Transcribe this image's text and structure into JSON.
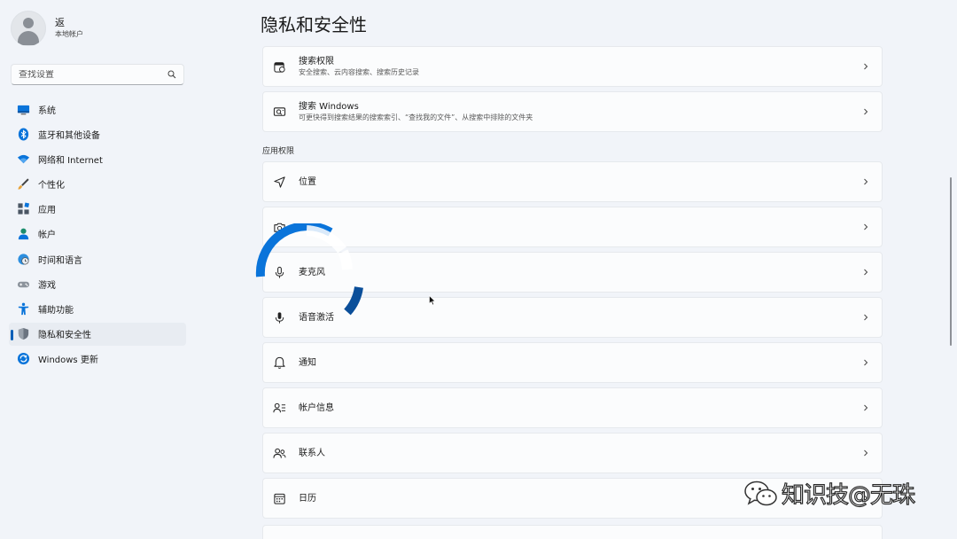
{
  "user": {
    "name": "返",
    "account_type": "本地帐户"
  },
  "search": {
    "placeholder": "查找设置"
  },
  "nav": [
    {
      "label": "系统",
      "icon": "monitor-icon"
    },
    {
      "label": "蓝牙和其他设备",
      "icon": "bluetooth-icon"
    },
    {
      "label": "网络和 Internet",
      "icon": "wifi-icon"
    },
    {
      "label": "个性化",
      "icon": "brush-icon"
    },
    {
      "label": "应用",
      "icon": "apps-icon"
    },
    {
      "label": "帐户",
      "icon": "account-icon"
    },
    {
      "label": "时间和语言",
      "icon": "globe-clock-icon"
    },
    {
      "label": "游戏",
      "icon": "gamepad-icon"
    },
    {
      "label": "辅助功能",
      "icon": "accessibility-icon"
    },
    {
      "label": "隐私和安全性",
      "icon": "shield-icon",
      "active": true
    },
    {
      "label": "Windows 更新",
      "icon": "update-icon"
    }
  ],
  "page": {
    "title": "隐私和安全性"
  },
  "top_cards": [
    {
      "title": "搜索权限",
      "desc": "安全搜索、云内容搜索、搜索历史记录",
      "icon": "search-permissions-icon"
    },
    {
      "title": "搜索 Windows",
      "desc": "可更快得到搜索结果的搜索索引、“查找我的文件”、从搜索中排除的文件夹",
      "icon": "search-windows-icon"
    }
  ],
  "section": {
    "app_permissions": "应用权限"
  },
  "app_permissions": [
    {
      "title": "位置",
      "icon": "location-icon"
    },
    {
      "title": "",
      "icon": "camera-icon"
    },
    {
      "title": "麦克风",
      "icon": "microphone-icon"
    },
    {
      "title": "语音激活",
      "icon": "voice-activation-icon"
    },
    {
      "title": "通知",
      "icon": "bell-icon"
    },
    {
      "title": "帐户信息",
      "icon": "account-info-icon"
    },
    {
      "title": "联系人",
      "icon": "contacts-icon"
    },
    {
      "title": "日历",
      "icon": "calendar-icon"
    }
  ],
  "watermark": {
    "text": "知识技@无珠"
  },
  "colors": {
    "accent": "#005fb8",
    "background": "#f1f4f9",
    "card": "#fbfcfd"
  }
}
